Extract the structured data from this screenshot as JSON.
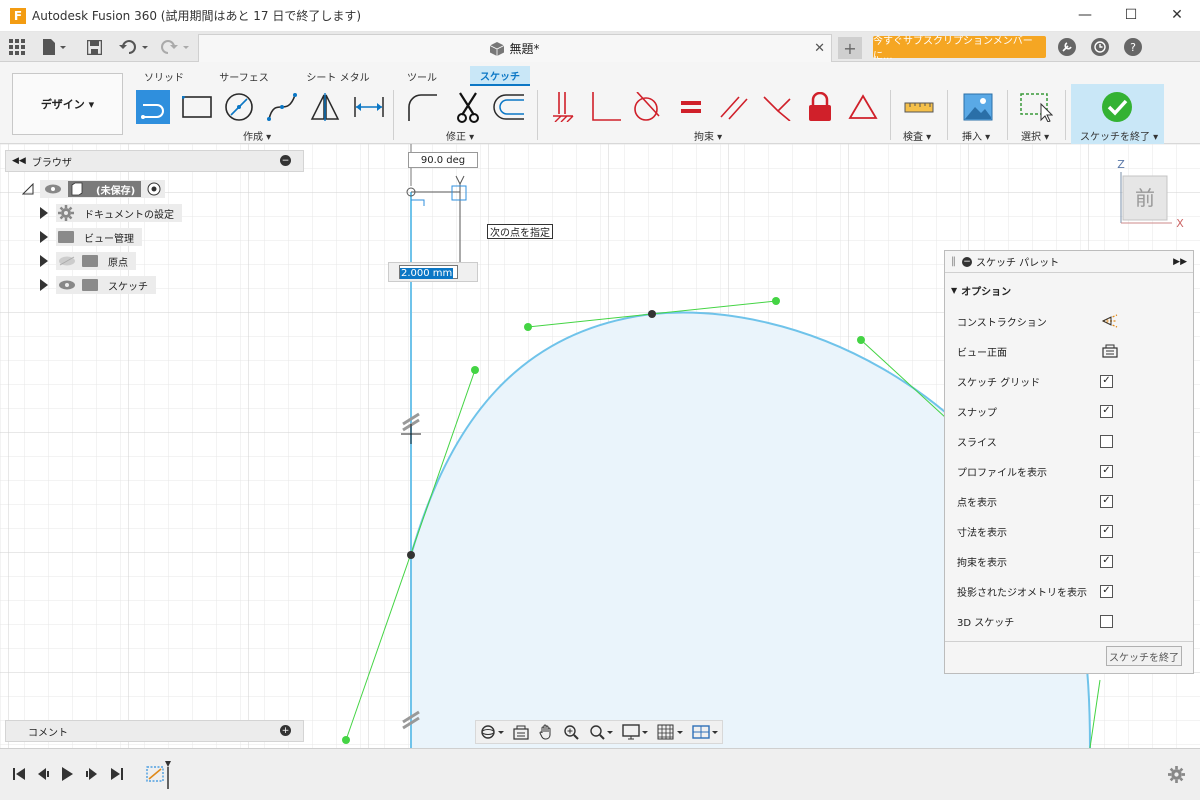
{
  "window": {
    "title": "Autodesk Fusion 360 (試用期間はあと 17 日で終了します)",
    "app_icon": "F",
    "minimize": "—",
    "maximize": "☐",
    "close": "✕"
  },
  "quickbar": {
    "doc_tab_title": "無題*",
    "subscribe_label": "今すぐサブスクリプションメンバーに..."
  },
  "ribbon": {
    "workspace": "デザイン ▾",
    "tabs": [
      "ソリッド",
      "サーフェス",
      "シート メタル",
      "ツール",
      "スケッチ"
    ],
    "groups": [
      "作成 ▾",
      "修正 ▾",
      "拘束 ▾",
      "検査 ▾",
      "挿入 ▾",
      "選択 ▾",
      "スケッチを終了 ▾"
    ]
  },
  "browser": {
    "title": "ブラウザ",
    "root_label": "(未保存)",
    "items": [
      {
        "label": "ドキュメントの設定"
      },
      {
        "label": "ビュー管理"
      },
      {
        "label": "原点"
      },
      {
        "label": "スケッチ"
      }
    ]
  },
  "canvas": {
    "angle_value": "90.0 deg",
    "length_value": "2.000 mm",
    "tooltip": "次の点を指定",
    "viewcube_face": "前",
    "axis_z": "Z",
    "axis_x": "X"
  },
  "palette": {
    "title": "スケッチ パレット",
    "section": "オプション",
    "rows": [
      {
        "label": "コンストラクション",
        "type": "icon",
        "checked": false
      },
      {
        "label": "ビュー正面",
        "type": "icon",
        "checked": false
      },
      {
        "label": "スケッチ グリッド",
        "type": "checkbox",
        "checked": true
      },
      {
        "label": "スナップ",
        "type": "checkbox",
        "checked": true
      },
      {
        "label": "スライス",
        "type": "checkbox",
        "checked": false
      },
      {
        "label": "プロファイルを表示",
        "type": "checkbox",
        "checked": true
      },
      {
        "label": "点を表示",
        "type": "checkbox",
        "checked": true
      },
      {
        "label": "寸法を表示",
        "type": "checkbox",
        "checked": true
      },
      {
        "label": "拘束を表示",
        "type": "checkbox",
        "checked": true
      },
      {
        "label": "投影されたジオメトリを表示",
        "type": "checkbox",
        "checked": true
      },
      {
        "label": "3D スケッチ",
        "type": "checkbox",
        "checked": false
      }
    ],
    "finish_button": "スケッチを終了"
  },
  "comments": {
    "title": "コメント"
  },
  "colors": {
    "accent": "#0b77c5",
    "sketch_curve": "#6fc3ea",
    "profile_fill": "#eaf4fb",
    "handle_green": "#44d444",
    "subscribe_orange": "#f5a623",
    "finish_check": "#34b233"
  }
}
